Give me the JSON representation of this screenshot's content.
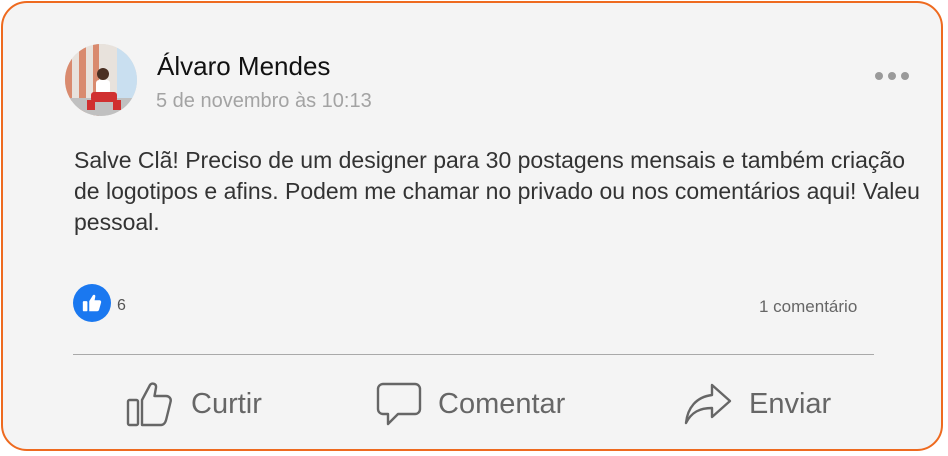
{
  "post": {
    "author": "Álvaro Mendes",
    "timestamp": "5 de novembro às 10:13",
    "text": "Salve Clã! Preciso de um designer para 30 postagens mensais e também criação de logotipos e afins. Podem me chamar no privado ou nos comentários aqui! Valeu pessoal.",
    "like_count": "6",
    "comment_count": "1 comentário"
  },
  "actions": {
    "like_label": "Curtir",
    "comment_label": "Comentar",
    "share_label": "Enviar"
  },
  "colors": {
    "border": "#ee6a1f",
    "card_background": "#f4f4f4",
    "like_blue": "#1a78f0",
    "action_gray": "#666666"
  },
  "icons": {
    "menu": "more-dots-icon",
    "reaction": "thumbs-up-icon",
    "like": "thumbs-up-outline-icon",
    "comment": "speech-bubble-icon",
    "share": "share-arrow-icon"
  }
}
